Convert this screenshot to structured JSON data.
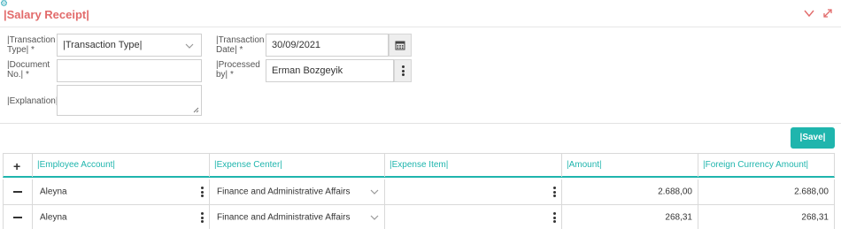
{
  "header": {
    "title": "|Salary Receipt|",
    "icons": [
      "gear-icon",
      "chevron-down-icon",
      "expand-icon"
    ],
    "accent_color": "#e26b6b"
  },
  "form": {
    "transaction_type": {
      "label": "|Transaction Type| *",
      "value": "|Transaction Type|"
    },
    "document_no": {
      "label": "|Document No.| *",
      "value": ""
    },
    "explanation": {
      "label": "|Explanation|",
      "value": ""
    },
    "transaction_date": {
      "label": "|Transaction Date| *",
      "value": "30/09/2021"
    },
    "processed_by": {
      "label": "|Processed by| *",
      "value": "Erman Bozgeyik"
    }
  },
  "save_button": {
    "label": "|Save|",
    "color": "#1fb5ad"
  },
  "table": {
    "columns": [
      "|Employee Account|",
      "|Expense Center|",
      "|Expense Item|",
      "|Amount|",
      "|Foreign Currency Amount|"
    ],
    "rows": [
      {
        "employee_account": "Aleyna",
        "expense_center": "Finance and Administrative Affairs",
        "expense_item": "",
        "amount": "2.688,00",
        "foreign_currency_amount": "2.688,00"
      },
      {
        "employee_account": "Aleyna",
        "expense_center": "Finance and Administrative Affairs",
        "expense_item": "",
        "amount": "268,31",
        "foreign_currency_amount": "268,31"
      }
    ]
  }
}
